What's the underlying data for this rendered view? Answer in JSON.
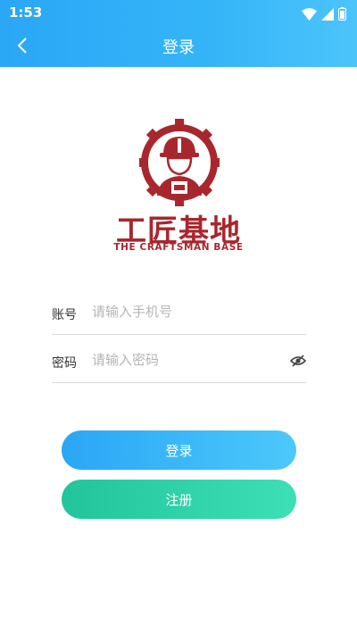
{
  "status_bar": {
    "time": "1:53"
  },
  "header": {
    "title": "登录"
  },
  "logo": {
    "title": "工匠基地",
    "subtitle": "THE CRAFTSMAN BASE"
  },
  "form": {
    "account": {
      "label": "账号",
      "placeholder": "请输入手机号"
    },
    "password": {
      "label": "密码",
      "placeholder": "请输入密码"
    }
  },
  "buttons": {
    "login": "登录",
    "register": "注册"
  },
  "colors": {
    "header": "#35b5f8",
    "brand": "#a8272e",
    "login_button": "#2aa6f5",
    "register_button": "#22c59b"
  },
  "icons": {
    "back": "chevron-left-icon",
    "password_visibility": "eye-off-icon",
    "wifi": "wifi-icon",
    "signal": "signal-icon",
    "battery": "battery-icon"
  }
}
